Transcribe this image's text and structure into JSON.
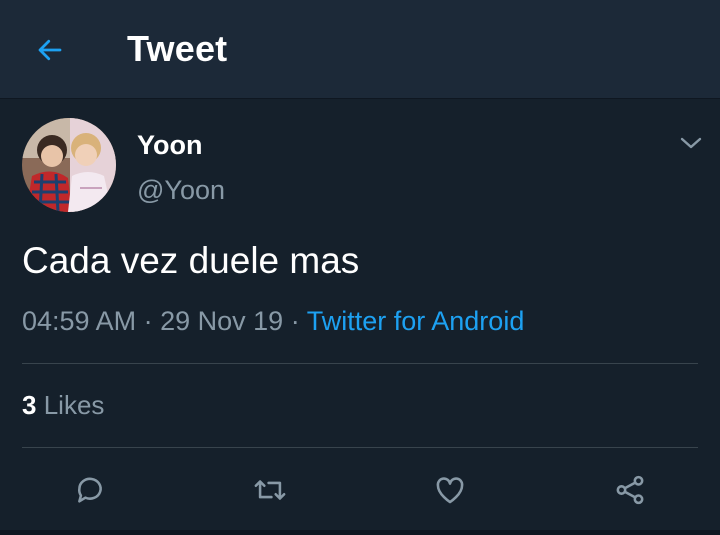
{
  "header": {
    "title": "Tweet",
    "back_icon": "arrow-left-icon"
  },
  "colors": {
    "background": "#15202b",
    "header_background": "#1c2938",
    "accent": "#1da1f2",
    "secondary_text": "#8899a6",
    "divider": "#38444d"
  },
  "tweet": {
    "author_name": "Yoon",
    "author_handle": "@Yoon",
    "text": "Cada vez duele mas",
    "time": "04:59 AM",
    "separator": "·",
    "date": "29 Nov 19",
    "source": "Twitter for Android",
    "likes_count": "3",
    "likes_label": "Likes",
    "menu_icon": "chevron-down-icon"
  },
  "actions": [
    {
      "icon": "reply-icon"
    },
    {
      "icon": "retweet-icon"
    },
    {
      "icon": "heart-icon"
    },
    {
      "icon": "share-icon"
    }
  ]
}
